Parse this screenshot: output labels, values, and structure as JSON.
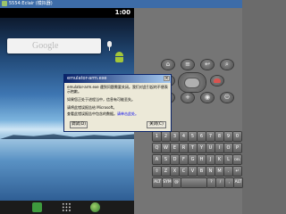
{
  "window": {
    "title": "5554:Eclair (模拟器)"
  },
  "status_bar": {
    "time": "1:00"
  },
  "home": {
    "search_brand": "Google",
    "dock": [
      "phone-icon",
      "all-apps-icon",
      "browser-icon"
    ]
  },
  "dialog": {
    "title": "emulator-arm.exe",
    "lines": [
      "emulator-arm.exe 遇到问题需要关闭。我们对此引起的不便表",
      "示抱歉。",
      "",
      "如果您正处于进程当中，信息有可能丢失。",
      "",
      "请将此错误报告给 Microsoft。",
      "查看此错误报告中包含的数据。"
    ],
    "link_text": "请单击此处。",
    "ok_label": "调试(D)",
    "cancel_label": "关闭(C)"
  },
  "keyboard": {
    "rows": [
      [
        "1",
        "2",
        "3",
        "4",
        "5",
        "6",
        "7",
        "8",
        "9",
        "0"
      ],
      [
        "Q",
        "W",
        "E",
        "R",
        "T",
        "Y",
        "U",
        "I",
        "O",
        "P"
      ],
      [
        "A",
        "S",
        "D",
        "F",
        "G",
        "H",
        "J",
        "K",
        "L",
        "DEL"
      ],
      [
        "⇧",
        "Z",
        "X",
        "C",
        "V",
        "B",
        "N",
        "M",
        ".",
        "↵"
      ],
      [
        "ALT",
        "SYM",
        "@",
        "",
        "?",
        "/",
        ",",
        "ALT"
      ]
    ]
  },
  "colors": {
    "titlebar": "#3d6ca8",
    "dialog_title": "#0a246a",
    "android_green": "#a4c639"
  }
}
